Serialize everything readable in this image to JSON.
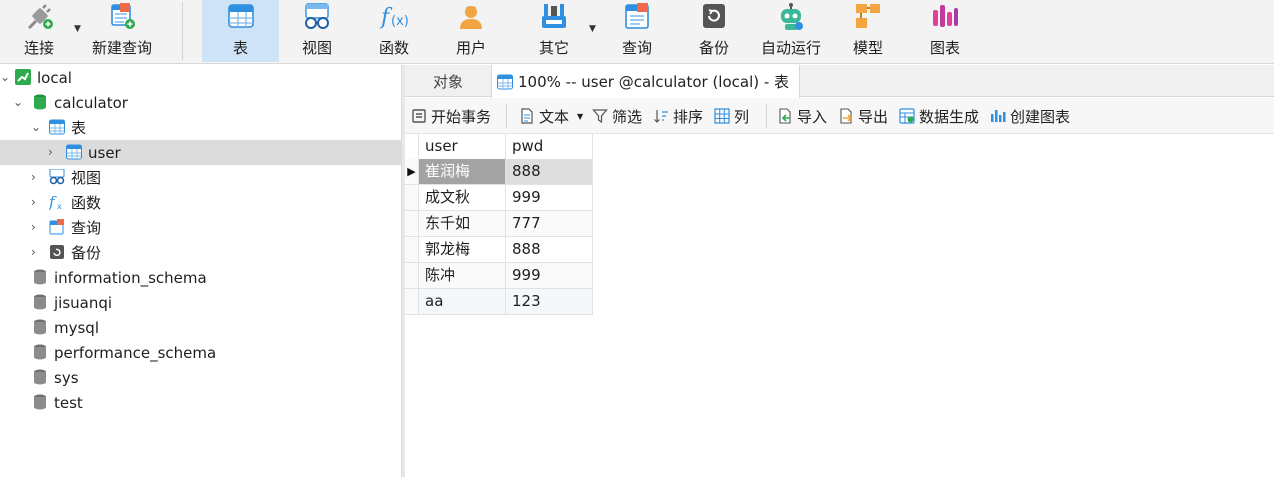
{
  "toolbar": {
    "items": [
      {
        "label": "连接",
        "icon": "connect-plug-icon"
      },
      {
        "label": "新建查询",
        "icon": "new-query-icon"
      },
      {
        "label": "表",
        "icon": "table-icon"
      },
      {
        "label": "视图",
        "icon": "view-glasses-icon"
      },
      {
        "label": "函数",
        "icon": "function-fx-icon"
      },
      {
        "label": "用户",
        "icon": "user-icon"
      },
      {
        "label": "其它",
        "icon": "tools-icon"
      },
      {
        "label": "查询",
        "icon": "query-icon"
      },
      {
        "label": "备份",
        "icon": "backup-icon"
      },
      {
        "label": "自动运行",
        "icon": "robot-icon"
      },
      {
        "label": "模型",
        "icon": "model-icon"
      },
      {
        "label": "图表",
        "icon": "chart-icon"
      }
    ],
    "active": "表"
  },
  "sidebar": {
    "connection": "local",
    "database": "calculator",
    "groups": [
      "表",
      "视图",
      "函数",
      "查询",
      "备份"
    ],
    "tables": [
      "user"
    ],
    "other_databases": [
      "information_schema",
      "jisuanqi",
      "mysql",
      "performance_schema",
      "sys",
      "test"
    ]
  },
  "tabs": [
    {
      "label": "对象"
    },
    {
      "label": "100% -- user @calculator (local) - 表"
    }
  ],
  "subtoolbar": {
    "begin_transaction": "开始事务",
    "text": "文本",
    "filter": "筛选",
    "sort": "排序",
    "columns": "列",
    "import": "导入",
    "export": "导出",
    "data_generation": "数据生成",
    "create_chart": "创建图表"
  },
  "grid": {
    "columns": [
      "user",
      "pwd"
    ],
    "rows": [
      [
        "崔润梅",
        "888"
      ],
      [
        "成文秋",
        "999"
      ],
      [
        "东千如",
        "777"
      ],
      [
        "郭龙梅",
        "888"
      ],
      [
        "陈冲",
        "999"
      ],
      [
        "aa",
        "123"
      ]
    ]
  },
  "colors": {
    "toolbar_bg": "#f3f3f3",
    "active_tool_bg": "#cfe3f7",
    "selected_tree_row": "#dcdcdc",
    "accent_blue": "#2f8fe0",
    "db_green": "#2eaa4f"
  }
}
